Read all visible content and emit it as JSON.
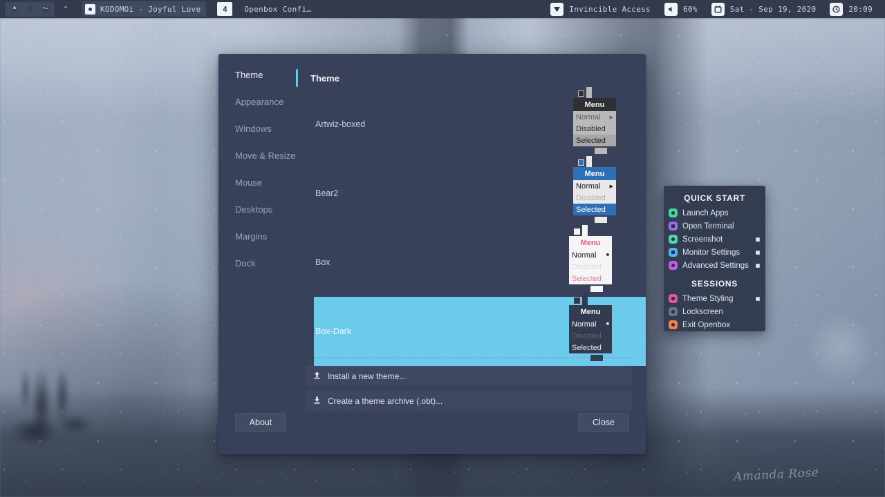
{
  "panel": {
    "launchers": [
      {
        "name": "mountain-icon",
        "glyph": "▲"
      },
      {
        "name": "leaf-icon",
        "glyph": "◗"
      },
      {
        "name": "palette-icon",
        "glyph": "●"
      }
    ],
    "expand_arrow": "⌃",
    "tasks": [
      {
        "label": "KODOMOi - Joyful Love",
        "icon": "disc-icon",
        "active": true
      },
      {
        "label": "Openbox Confi…",
        "icon": "window-icon",
        "active": false
      }
    ],
    "desktop_number": "4",
    "tray": [
      {
        "name": "network-vpn",
        "icon": "▼",
        "label": "Invincible Access"
      },
      {
        "name": "volume",
        "icon": "◆",
        "label": "60%"
      },
      {
        "name": "calendar",
        "icon": "▣",
        "label": "Sat - Sep 19, 2020"
      },
      {
        "name": "clock",
        "icon": "◔",
        "label": "20:09"
      }
    ]
  },
  "obconf": {
    "sidebar": [
      {
        "label": "Theme",
        "selected": true
      },
      {
        "label": "Appearance",
        "selected": false
      },
      {
        "label": "Windows",
        "selected": false
      },
      {
        "label": "Move & Resize",
        "selected": false
      },
      {
        "label": "Mouse",
        "selected": false
      },
      {
        "label": "Desktops",
        "selected": false
      },
      {
        "label": "Margins",
        "selected": false
      },
      {
        "label": "Dock",
        "selected": false
      }
    ],
    "page_title": "Theme",
    "accent_color": "#6ec6e8",
    "selection_color": "#6ccbec",
    "themes": [
      {
        "name": "Artwiz-boxed",
        "selected": false,
        "preview": {
          "title_bg": "#2f3034",
          "title_fg": "#f2f2f2",
          "menu_bg": "#b9b9b9",
          "normal_fg": "#5f6063",
          "disabled_fg": "#2d2e31",
          "selected_bg": "#a8a8a8",
          "selected_fg": "#1f2022",
          "arrow": "▶"
        }
      },
      {
        "name": "Bear2",
        "selected": false,
        "preview": {
          "title_bg": "#2f6fb5",
          "title_fg": "#ffffff",
          "menu_bg": "#e8e8e8",
          "normal_fg": "#18191b",
          "disabled_fg": "#b4b4b4",
          "selected_bg": "#2f6fb5",
          "selected_fg": "#ffffff",
          "arrow": "▶"
        }
      },
      {
        "name": "Box",
        "selected": false,
        "preview": {
          "title_bg": "#f5f5f5",
          "title_fg": "#f05a8c",
          "menu_bg": "#f5f5f5",
          "normal_fg": "#1b1c1e",
          "disabled_fg": "#dcdcdc",
          "selected_bg": "#f5f5f5",
          "selected_fg": "#f07ba8",
          "arrow": "■"
        }
      },
      {
        "name": "Box-Dark",
        "selected": true,
        "preview": {
          "title_bg": "#333b4f",
          "title_fg": "#ffffff",
          "menu_bg": "#333b4f",
          "normal_fg": "#f2f4f8",
          "disabled_fg": "#5b6377",
          "selected_bg": "#333b4f",
          "selected_fg": "#dfe4ee",
          "arrow": "■"
        }
      }
    ],
    "preview_labels": {
      "title": "Menu",
      "normal": "Normal",
      "disabled": "Disabled",
      "selected": "Selected"
    },
    "actions": [
      {
        "label": "Install a new theme...",
        "icon": "upload-icon",
        "glyph": "⬆"
      },
      {
        "label": "Create a theme archive (.obt)...",
        "icon": "download-icon",
        "glyph": "⬇"
      }
    ],
    "footer": {
      "about_label": "About",
      "close_label": "Close"
    }
  },
  "quickstart": {
    "section1_title": "QUICK START",
    "section2_title": "SESSIONS",
    "items1": [
      {
        "label": "Launch Apps",
        "icon": "search-apps-icon",
        "color": "#3fd6a0",
        "shape": "dot",
        "mark": false
      },
      {
        "label": "Open Terminal",
        "icon": "terminal-icon",
        "color": "#9a6cf0",
        "shape": "sq",
        "mark": false
      },
      {
        "label": "Screenshot",
        "icon": "camera-icon",
        "color": "#49d6b0",
        "shape": "dot",
        "mark": true
      },
      {
        "label": "Monitor Settings",
        "icon": "monitor-icon",
        "color": "#45b6f0",
        "shape": "sq",
        "mark": true
      },
      {
        "label": "Advanced Settings",
        "icon": "gear-icon",
        "color": "#c35ae8",
        "shape": "dot",
        "mark": true
      }
    ],
    "items2": [
      {
        "label": "Theme Styling",
        "icon": "palette-icon",
        "color": "#e0559c",
        "shape": "dot",
        "mark": true
      },
      {
        "label": "Lockscreen",
        "icon": "lock-icon",
        "color": "#6a7486",
        "shape": "dot",
        "mark": false
      },
      {
        "label": "Exit Openbox",
        "icon": "power-icon",
        "color": "#f0804d",
        "shape": "dot",
        "mark": false
      }
    ]
  },
  "wallpaper": {
    "signature": "Amanda Rose"
  }
}
